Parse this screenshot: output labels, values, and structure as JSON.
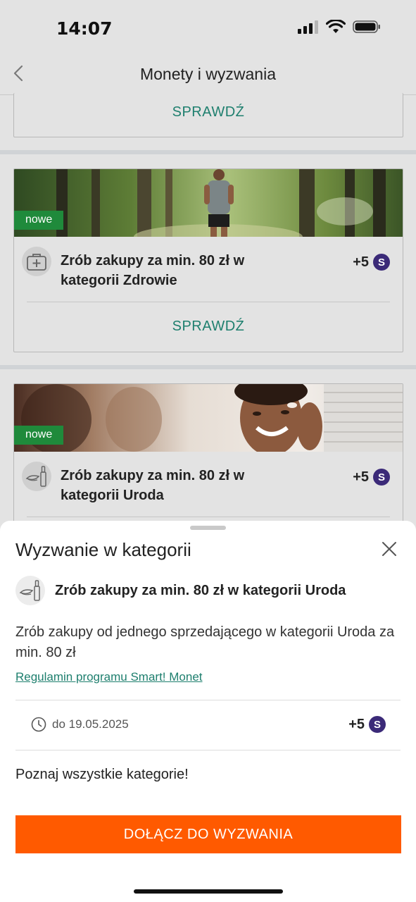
{
  "status_bar": {
    "time": "14:07"
  },
  "nav": {
    "title": "Monety i wyzwania"
  },
  "cards": [
    {
      "cta": "SPRAWDŹ"
    },
    {
      "badge": "nowe",
      "title": "Zrób zakupy za min. 80 zł w kategorii Zdrowie",
      "reward": "+5",
      "coin_letter": "S",
      "cta": "SPRAWDŹ",
      "icon": "first-aid-kit-icon"
    },
    {
      "badge": "nowe",
      "title": "Zrób zakupy za min. 80 zł w kategorii Uroda",
      "reward": "+5",
      "coin_letter": "S",
      "icon": "beauty-cosmetics-icon"
    }
  ],
  "sheet": {
    "title": "Wyzwanie w kategorii",
    "challenge_title": "Zrób zakupy za min. 80 zł w kategorii Uroda",
    "description": "Zrób zakupy od jednego sprzedającego w kategorii Uroda za min. 80 zł",
    "terms_link": "Regulamin programu Smart! Monet",
    "deadline": "do 19.05.2025",
    "reward": "+5",
    "coin_letter": "S",
    "explore_text": "Poznaj wszystkie kategorie!",
    "join_button": "DOŁĄCZ DO WYZWANIA"
  },
  "colors": {
    "accent_green": "#1e7f6e",
    "badge_green": "#1f8a3b",
    "coin_purple": "#3b2a78",
    "cta_orange": "#ff5a00"
  }
}
